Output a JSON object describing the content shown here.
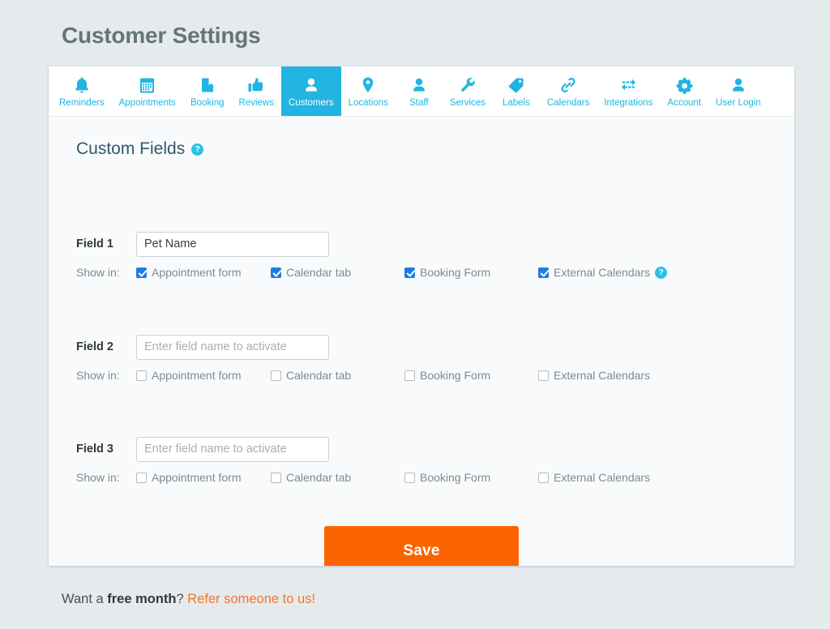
{
  "page": {
    "title": "Customer Settings"
  },
  "tabs": [
    {
      "label": "Reminders",
      "icon": "bell-icon",
      "active": false
    },
    {
      "label": "Appointments",
      "icon": "calendar-icon",
      "active": false
    },
    {
      "label": "Booking",
      "icon": "book-icon",
      "active": false
    },
    {
      "label": "Reviews",
      "icon": "thumbs-up-icon",
      "active": false
    },
    {
      "label": "Customers",
      "icon": "person-icon",
      "active": true
    },
    {
      "label": "Locations",
      "icon": "map-pin-icon",
      "active": false
    },
    {
      "label": "Staff",
      "icon": "person-icon",
      "active": false
    },
    {
      "label": "Services",
      "icon": "wrench-icon",
      "active": false
    },
    {
      "label": "Labels",
      "icon": "tag-icon",
      "active": false
    },
    {
      "label": "Calendars",
      "icon": "link-icon",
      "active": false
    },
    {
      "label": "Integrations",
      "icon": "exchange-icon",
      "active": false
    },
    {
      "label": "Account",
      "icon": "gear-icon",
      "active": false
    },
    {
      "label": "User Login",
      "icon": "person-icon",
      "active": false
    }
  ],
  "section": {
    "title": "Custom Fields",
    "help_icon": "?"
  },
  "labels": {
    "show_in": "Show in:",
    "appointment_form": "Appointment form",
    "calendar_tab": "Calendar tab",
    "booking_form": "Booking Form",
    "external_calendars": "External Calendars",
    "placeholder": "Enter field name to activate",
    "help_icon": "?"
  },
  "fields": [
    {
      "label": "Field 1",
      "value": "Pet Name",
      "placeholder": "",
      "appointment_form": true,
      "calendar_tab": true,
      "booking_form": true,
      "external_calendars": true,
      "has_help": true
    },
    {
      "label": "Field 2",
      "value": "",
      "placeholder": "Enter field name to activate",
      "appointment_form": false,
      "calendar_tab": false,
      "booking_form": false,
      "external_calendars": false,
      "has_help": false
    },
    {
      "label": "Field 3",
      "value": "",
      "placeholder": "Enter field name to activate",
      "appointment_form": false,
      "calendar_tab": false,
      "booking_form": false,
      "external_calendars": false,
      "has_help": false
    }
  ],
  "save": {
    "label": "Save"
  },
  "footer": {
    "text_before": "Want a ",
    "bold": "free month",
    "text_middle": "? ",
    "link": "Refer someone to us!"
  },
  "colors": {
    "accent": "#22b4e2",
    "save": "#fa6400",
    "link": "#f2762e",
    "checkbox": "#1c7ee0",
    "page_bg": "#e5eaec",
    "card_bg": "#f8fafb"
  }
}
